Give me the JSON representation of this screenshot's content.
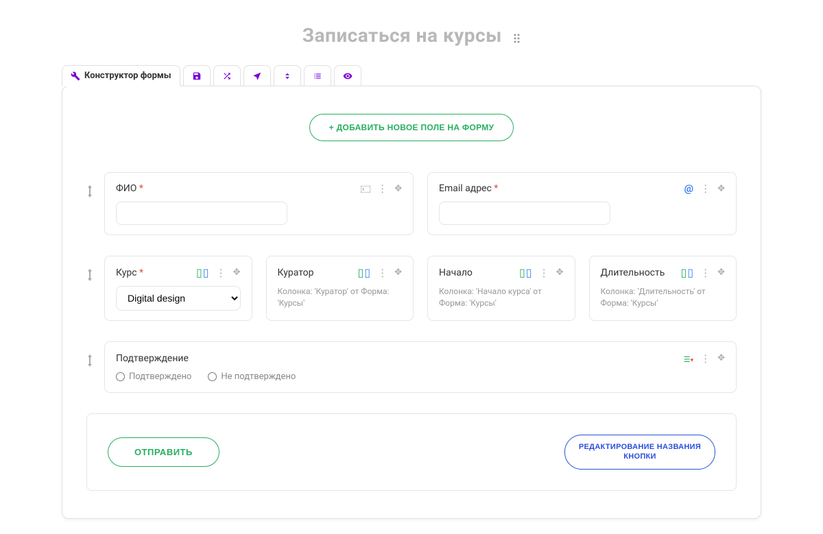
{
  "title": "Записаться на курсы",
  "tabs": {
    "active_label": "Конструктор формы"
  },
  "add_field_label": "+ ДОБАВИТЬ НОВОЕ ПОЛЕ НА ФОРМУ",
  "rows": [
    {
      "fields": [
        {
          "label": "ФИО",
          "required": true,
          "type": "text"
        },
        {
          "label": "Email адрес",
          "required": true,
          "type": "email"
        }
      ]
    },
    {
      "fields": [
        {
          "label": "Курс",
          "required": true,
          "type": "select",
          "selected": "Digital design"
        },
        {
          "label": "Куратор",
          "type": "lookup",
          "description": "Колонка: 'Куратор' от Форма: 'Курсы'"
        },
        {
          "label": "Начало",
          "type": "lookup",
          "description": "Колонка: 'Начало курса' от Форма: 'Курсы'"
        },
        {
          "label": "Длительность",
          "type": "lookup",
          "description": "Колонка: 'Длительность' от Форма: 'Курсы'"
        }
      ]
    },
    {
      "fields": [
        {
          "label": "Подтверждение",
          "type": "radio",
          "options": [
            "Подтверждено",
            "Не подтверждено"
          ]
        }
      ]
    }
  ],
  "submit": {
    "button_label": "ОТПРАВИТЬ",
    "edit_label": "РЕДАКТИРОВАНИЕ НАЗВАНИЯ КНОПКИ"
  }
}
